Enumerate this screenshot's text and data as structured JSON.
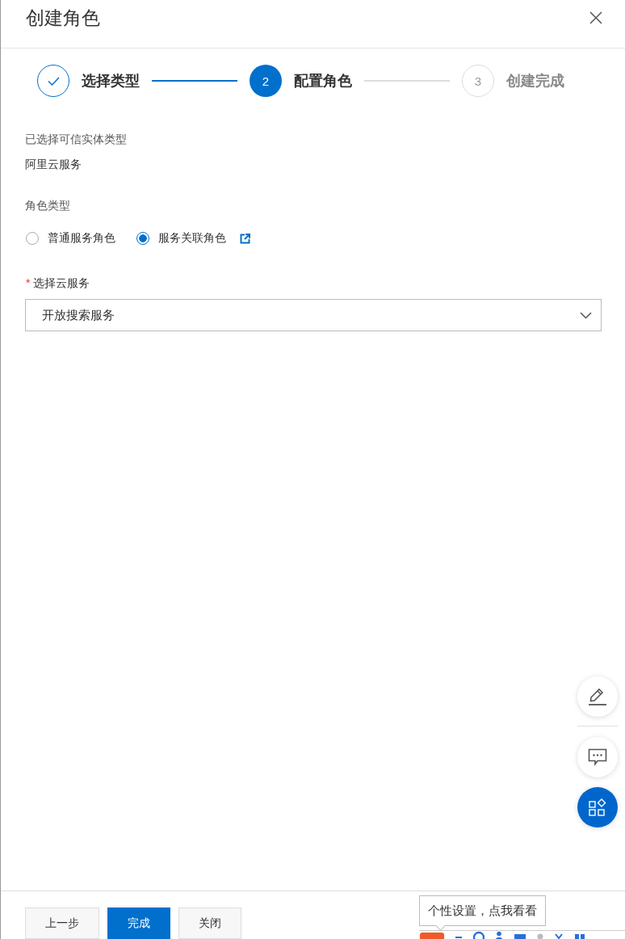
{
  "dialog": {
    "title": "创建角色"
  },
  "steps": [
    {
      "label": "选择类型",
      "completed": true,
      "selected": false
    },
    {
      "number": "2",
      "label": "配置角色",
      "completed": false,
      "selected": true
    },
    {
      "number": "3",
      "label": "创建完成",
      "completed": false,
      "selected": false
    }
  ],
  "trusted_entity": {
    "label": "已选择可信实体类型",
    "value": "阿里云服务"
  },
  "role_type": {
    "label": "角色类型",
    "options": [
      {
        "label": "普通服务角色",
        "selected": false,
        "external_link": false
      },
      {
        "label": "服务关联角色",
        "selected": true,
        "external_link": true
      }
    ]
  },
  "cloud_service": {
    "required_mark": "*",
    "label": "选择云服务",
    "value": "开放搜索服务"
  },
  "float_buttons": [
    {
      "kind": "edit",
      "primary": false
    },
    {
      "kind": "chat",
      "primary": false
    },
    {
      "kind": "apps",
      "primary": true
    }
  ],
  "footer": {
    "buttons": [
      {
        "label": "上一步",
        "primary": false
      },
      {
        "label": "完成",
        "primary": true
      },
      {
        "label": "关闭",
        "primary": false
      }
    ]
  },
  "tooltip": {
    "text": "个性设置，点我看看"
  }
}
